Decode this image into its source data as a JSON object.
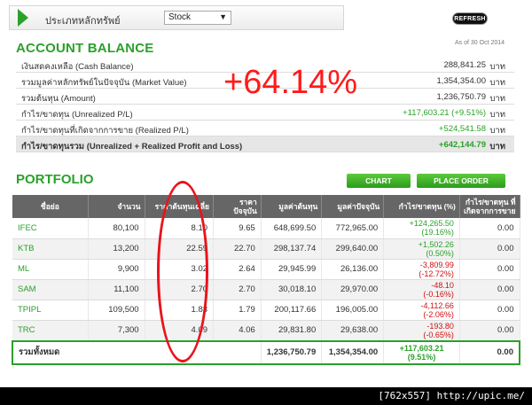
{
  "selector": {
    "label": "ประเภทหลักทรัพย์",
    "value": "Stock",
    "caret": "▼"
  },
  "refresh_label": "REFRESH",
  "account_balance": {
    "title": "ACCOUNT BALANCE",
    "as_of": "As of 30 Oct 2014",
    "rows": [
      {
        "label": "เงินสดคงเหลือ (Cash Balance)",
        "value": "288,841.25",
        "unit": "บาท"
      },
      {
        "label": "รวมมูลค่าหลักทรัพย์ในปัจจุบัน (Market Value)",
        "value": "1,354,354.00",
        "unit": "บาท"
      },
      {
        "label": "รวมต้นทุน (Amount)",
        "value": "1,236,750.79",
        "unit": "บาท"
      },
      {
        "label": "กำไร/ขาดทุน (Unrealized P/L)",
        "value": "+117,603.21 (+9.51%)",
        "unit": "บาท"
      },
      {
        "label": "กำไร/ขาดทุนที่เกิดจากการขาย (Realized P/L)",
        "value": "+524,541.58",
        "unit": "บาท"
      },
      {
        "label": "กำไร/ขาดทุนรวม (Unrealized + Realized Profit and Loss)",
        "value": "+642,144.79",
        "unit": "บาท"
      }
    ]
  },
  "annotation_pct": "+64.14%",
  "portfolio": {
    "title": "PORTFOLIO",
    "chart_button": "CHART",
    "order_button": "PLACE ORDER",
    "headers": [
      "ชื่อย่อ",
      "จำนวน",
      "ราคาต้นทุนเฉลี่ย",
      "ราคาปัจจุบัน",
      "มูลค่าต้นทุน",
      "มูลค่าปัจจุบัน",
      "กำไร/ขาดทุน (%)",
      "กำไร/ขาดทุน ที่เกิดจากการขาย"
    ],
    "rows": [
      {
        "symbol": "IFEC",
        "qty": "80,100",
        "avg_cost": "8.10",
        "price": "9.65",
        "cost_value": "648,699.50",
        "market_value": "772,965.00",
        "pl": "+124,265.50",
        "pl_pct": "(19.16%)",
        "realized": "0.00",
        "sign": "pos"
      },
      {
        "symbol": "KTB",
        "qty": "13,200",
        "avg_cost": "22.59",
        "price": "22.70",
        "cost_value": "298,137.74",
        "market_value": "299,640.00",
        "pl": "+1,502.26",
        "pl_pct": "(0.50%)",
        "realized": "0.00",
        "sign": "pos"
      },
      {
        "symbol": "ML",
        "qty": "9,900",
        "avg_cost": "3.02",
        "price": "2.64",
        "cost_value": "29,945.99",
        "market_value": "26,136.00",
        "pl": "-3,809.99",
        "pl_pct": "(-12.72%)",
        "realized": "0.00",
        "sign": "neg"
      },
      {
        "symbol": "SAM",
        "qty": "11,100",
        "avg_cost": "2.70",
        "price": "2.70",
        "cost_value": "30,018.10",
        "market_value": "29,970.00",
        "pl": "-48.10",
        "pl_pct": "(-0.16%)",
        "realized": "0.00",
        "sign": "neg"
      },
      {
        "symbol": "TPIPL",
        "qty": "109,500",
        "avg_cost": "1.83",
        "price": "1.79",
        "cost_value": "200,117.66",
        "market_value": "196,005.00",
        "pl": "-4,112.66",
        "pl_pct": "(-2.06%)",
        "realized": "0.00",
        "sign": "neg"
      },
      {
        "symbol": "TRC",
        "qty": "7,300",
        "avg_cost": "4.09",
        "price": "4.06",
        "cost_value": "29,831.80",
        "market_value": "29,638.00",
        "pl": "-193.80",
        "pl_pct": "(-0.65%)",
        "realized": "0.00",
        "sign": "neg"
      }
    ],
    "total": {
      "label": "รวมทั้งหมด",
      "cost_value": "1,236,750.79",
      "market_value": "1,354,354.00",
      "pl": "+117,603.21",
      "pl_pct": "(9.51%)",
      "realized": "0.00"
    }
  },
  "footer_text": "[762x557] http://upic.me/",
  "colors": {
    "accent_green": "#2aa12a",
    "negative_red": "#d01010",
    "annotation_red": "#ff1a1a"
  }
}
